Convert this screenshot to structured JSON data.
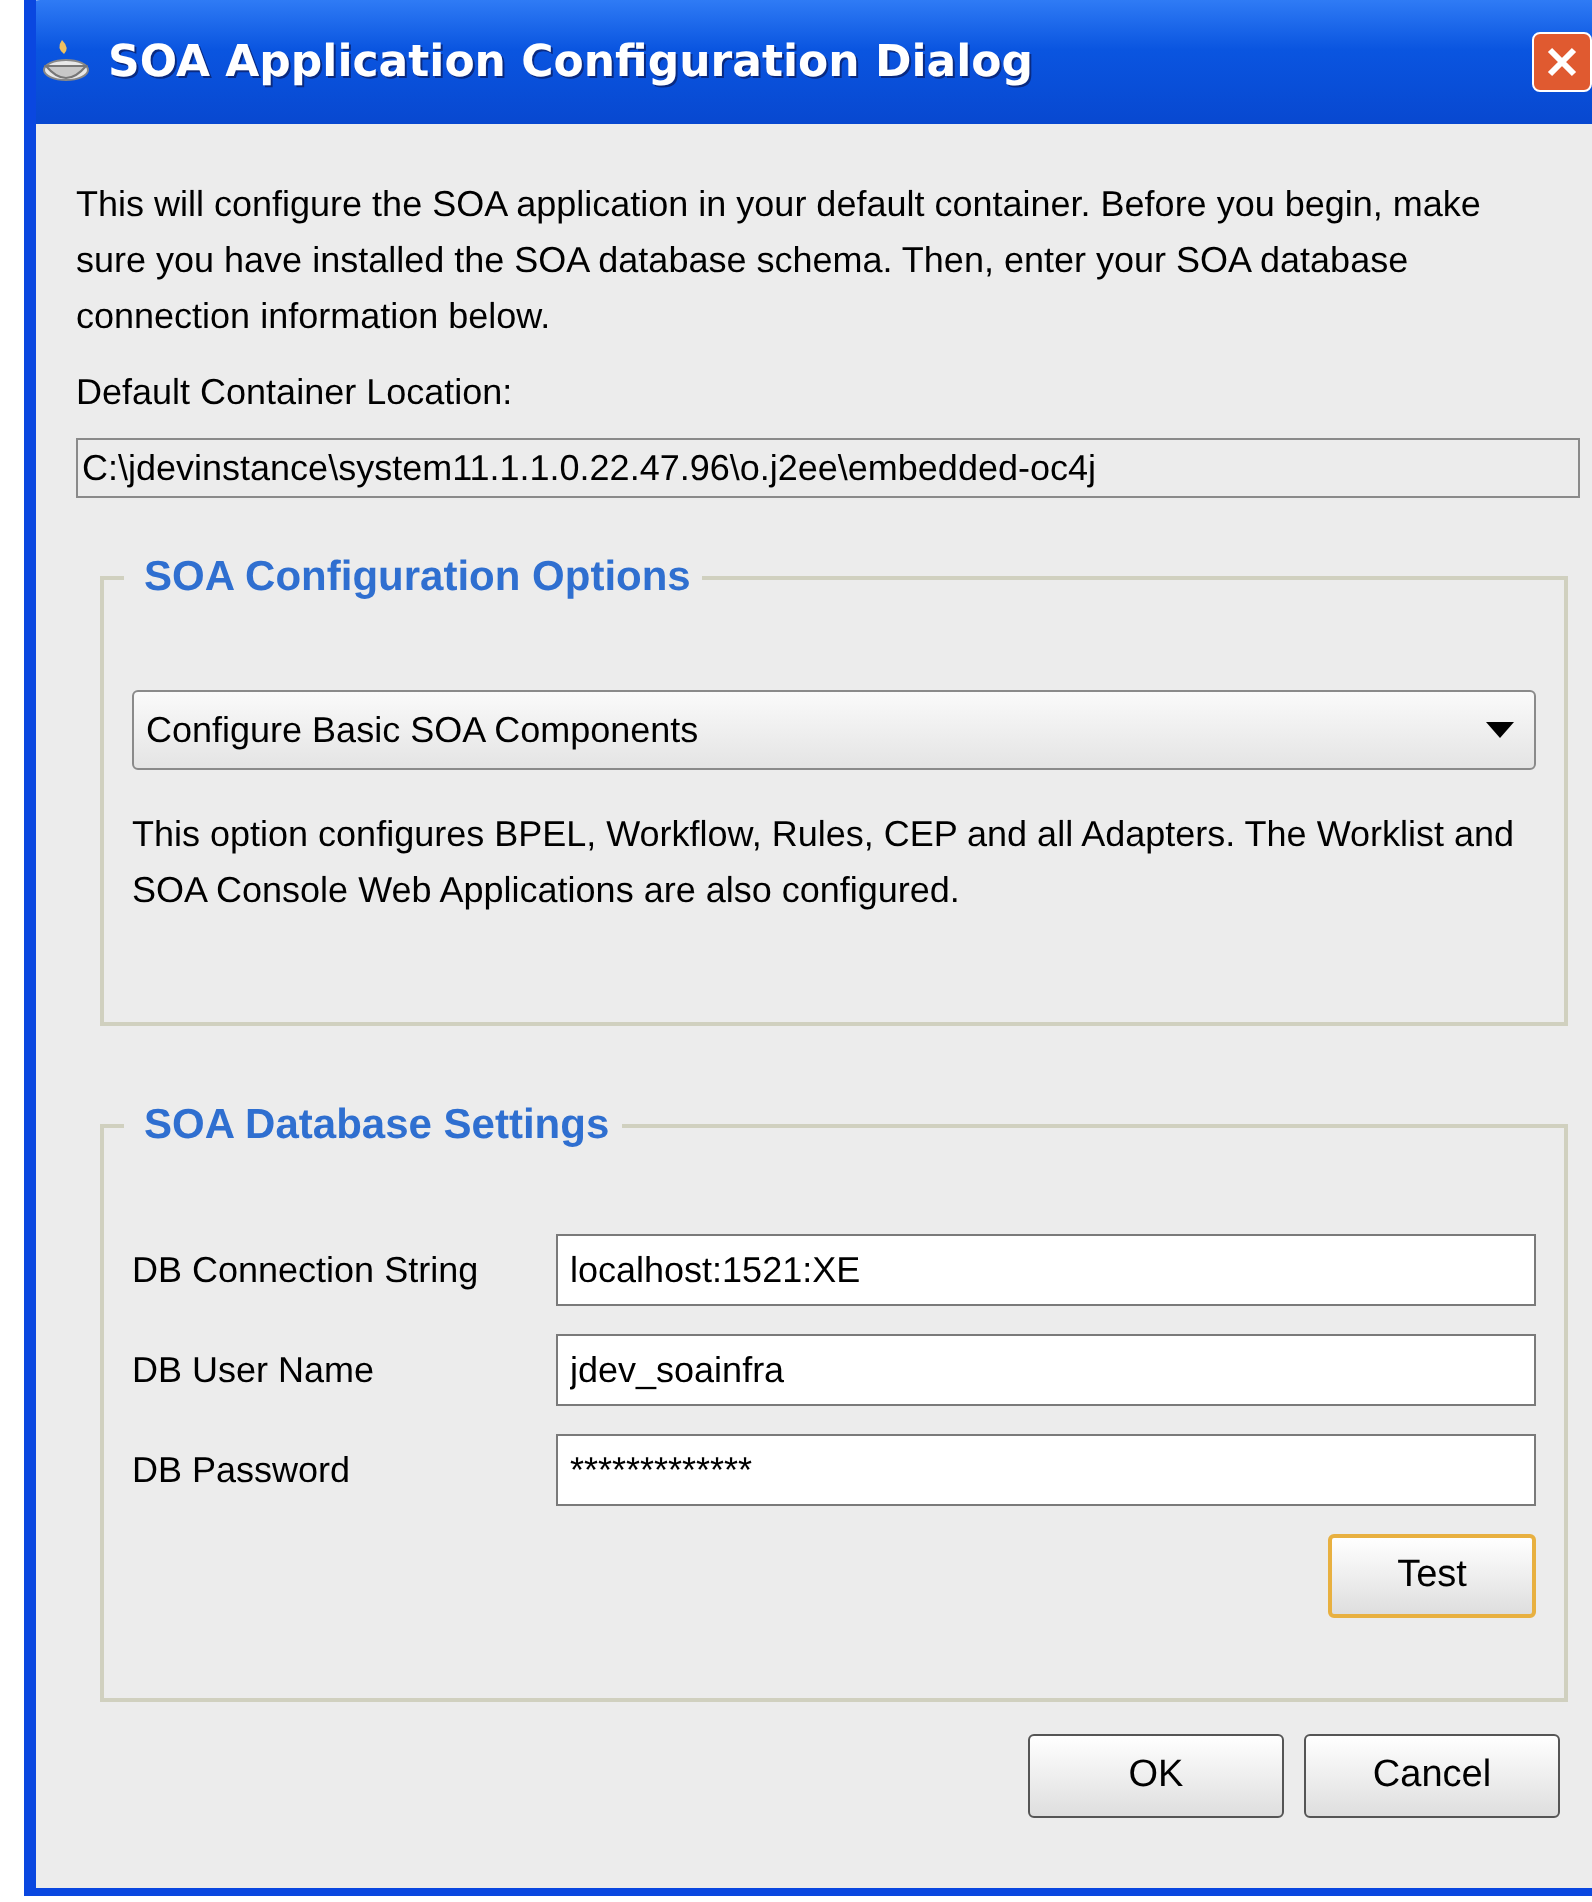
{
  "window": {
    "title": "SOA Application Configuration Dialog"
  },
  "intro": "This will configure the SOA application in your default container. Before you begin, make sure you have installed the SOA database schema. Then, enter your SOA database connection information below.",
  "container_location": {
    "label": "Default Container Location:",
    "value": "C:\\jdevinstance\\system11.1.1.0.22.47.96\\o.j2ee\\embedded-oc4j"
  },
  "config_options": {
    "legend": "SOA Configuration Options",
    "dropdown": "Configure Basic SOA Components",
    "description": "This option configures BPEL, Workflow, Rules, CEP and all Adapters. The Worklist and SOA Console Web Applications are also configured."
  },
  "db_settings": {
    "legend": "SOA Database Settings",
    "fields": [
      {
        "label": "DB Connection String",
        "value": "localhost:1521:XE"
      },
      {
        "label": "DB User Name",
        "value": "jdev_soainfra"
      },
      {
        "label": "DB Password",
        "value": "*************"
      }
    ],
    "test_button": {
      "label": "Test",
      "focused": true
    }
  },
  "buttons": [
    "OK",
    "Cancel"
  ]
}
